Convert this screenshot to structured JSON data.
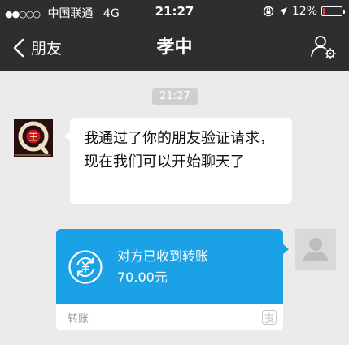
{
  "status_bar": {
    "carrier": "中国联通",
    "network": "4G",
    "time": "21:27",
    "battery_text": "12%",
    "battery_level": 0.12,
    "icons": [
      "signal-dots-icon",
      "rotation-lock-icon",
      "location-arrow-icon",
      "battery-icon"
    ]
  },
  "navbar": {
    "back_label": "朋友",
    "title": "孝中",
    "profile_icon": "user-settings-icon"
  },
  "chat": {
    "timestamp": "21:27",
    "incoming_message": "我通过了你的朋友验证请求，现在我们可以开始聊天了",
    "incoming_avatar_letter": "Q",
    "incoming_avatar_char": "王",
    "transfer": {
      "status": "对方已收到转账",
      "amount": "70.00元",
      "label": "转账",
      "icon": "transfer-received-icon",
      "logo": "alipay-style-logo-icon"
    },
    "outgoing_avatar_icon": "default-user-avatar-icon"
  },
  "colors": {
    "bar_background": "#2e2e30",
    "chat_background": "#ebebeb",
    "transfer_blue": "#1ba1e6",
    "battery_red": "#e53935"
  }
}
